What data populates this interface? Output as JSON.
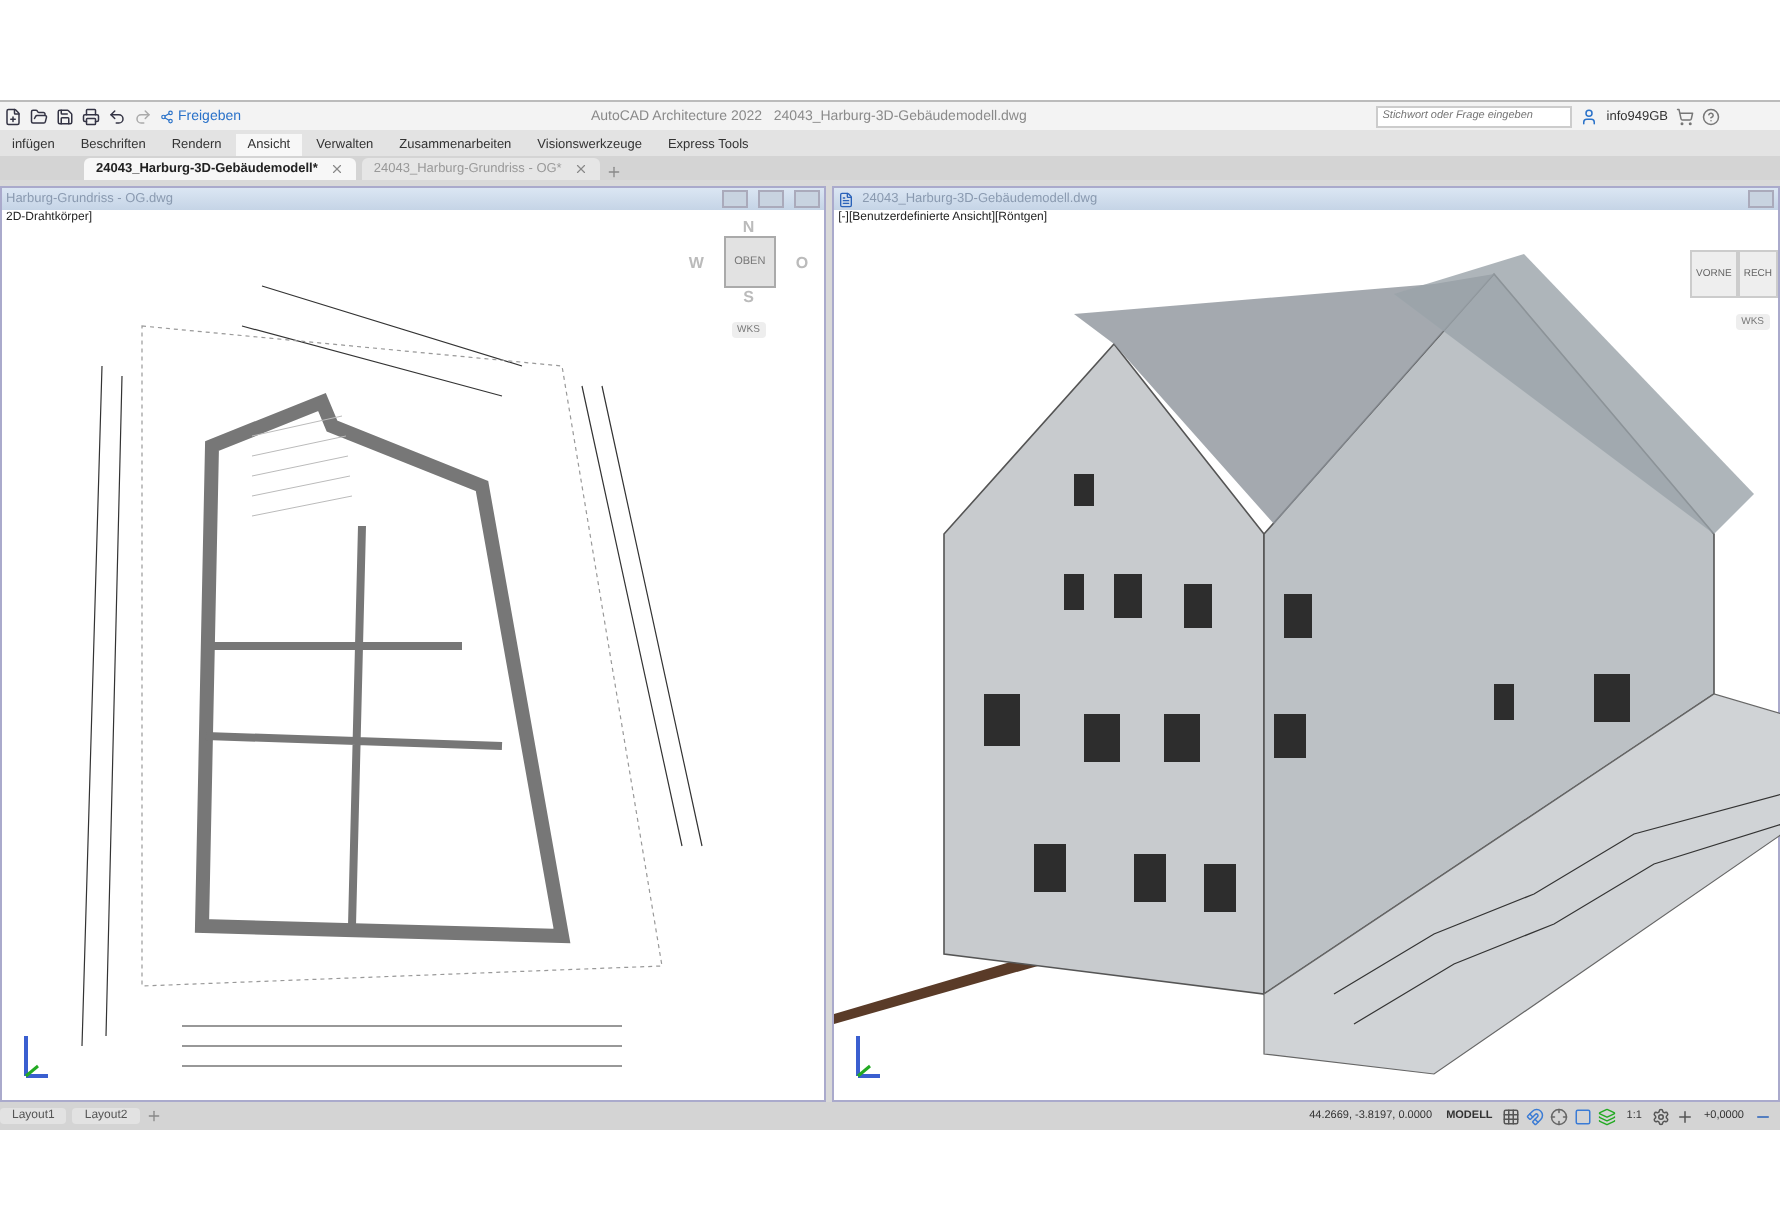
{
  "quick_access": {
    "share": "Freigeben",
    "title": "AutoCAD Architecture 2022",
    "filename": "24043_Harburg-3D-Gebäudemodell.dwg",
    "search": {
      "placeholder": "Stichwort oder Frage eingeben"
    },
    "user": "info949GB"
  },
  "ribbon_tabs": [
    {
      "label": "infügen",
      "selected": false
    },
    {
      "label": "Beschriften",
      "selected": false
    },
    {
      "label": "Rendern",
      "selected": false
    },
    {
      "label": "Ansicht",
      "selected": true
    },
    {
      "label": "Verwalten",
      "selected": false
    },
    {
      "label": "Zusammenarbeiten",
      "selected": false
    },
    {
      "label": "Visionswerkzeuge",
      "selected": false
    },
    {
      "label": "Express Tools",
      "selected": false
    }
  ],
  "file_tabs": [
    {
      "label": "24043_Harburg-3D-Gebäudemodell*",
      "selected": true
    },
    {
      "label": "24043_Harburg-Grundriss - OG*",
      "selected": false
    }
  ],
  "viewports": [
    {
      "kind": "plan",
      "title": "Harburg-Grundriss - OG.dwg",
      "view_label": "2D-Drahtkörper]",
      "viewcube": {
        "kind": "compass",
        "top": "OBEN",
        "north": "N",
        "west": "W",
        "east": "O",
        "south": "S",
        "ucs": "WKS"
      }
    },
    {
      "kind": "model",
      "title": "24043_Harburg-3D-Gebäudemodell.dwg",
      "view_label": "[-][Benutzerdefinierte Ansicht][Röntgen]",
      "viewcube": {
        "kind": "cube",
        "front": "VORNE",
        "right": "RECH",
        "ucs": "WKS"
      }
    }
  ],
  "layout_tabs": [
    {
      "label": "Layout1",
      "selected": false
    },
    {
      "label": "Layout2",
      "selected": false
    }
  ],
  "status_bar": {
    "coordinates": "44.2669, -3.8197, 0.0000",
    "space": "MODELL",
    "scale": "1:1",
    "offset": "+0,0000"
  }
}
